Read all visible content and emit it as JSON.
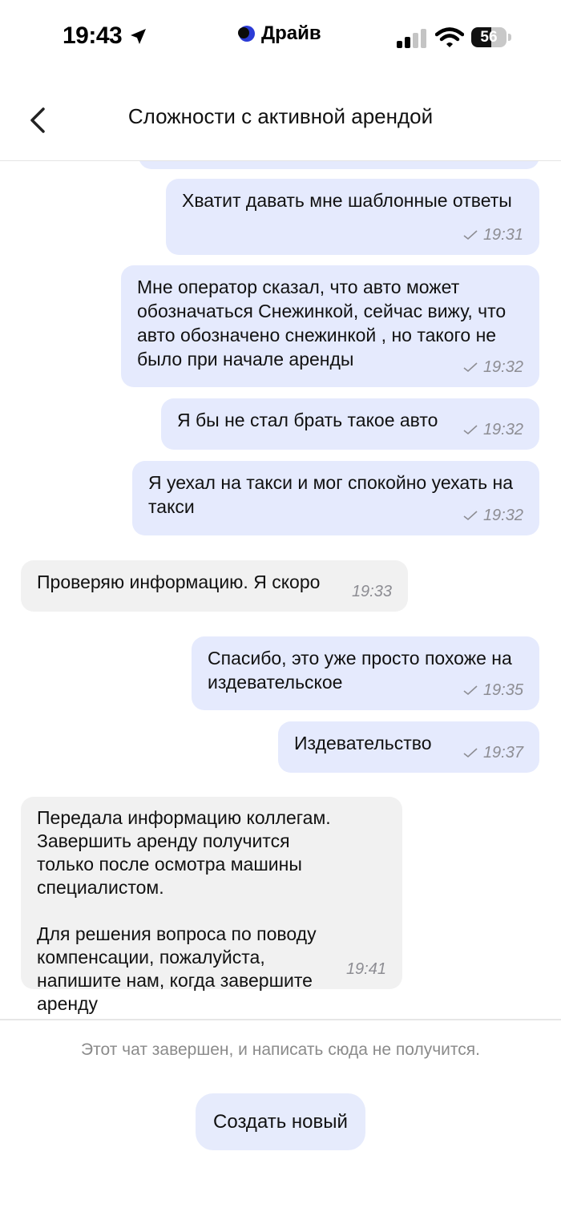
{
  "status_bar": {
    "time": "19:43",
    "app_name": "Драйв",
    "battery_level": "56"
  },
  "header": {
    "title": "Сложности с активной арендой"
  },
  "messages": [
    {
      "direction": "out",
      "text": "Хватит давать мне шаблонные ответы",
      "time": "19:31",
      "read": true
    },
    {
      "direction": "out",
      "text": "Мне оператор сказал, что авто может обозначаться Снежинкой, сейчас вижу, что авто обозначено снежинкой , но такого не было при начале аренды",
      "time": "19:32",
      "read": true
    },
    {
      "direction": "out",
      "text": "Я бы не стал брать такое авто",
      "time": "19:32",
      "read": true
    },
    {
      "direction": "out",
      "text": "Я уехал на такси и мог спокойно уехать на такси",
      "time": "19:32",
      "read": true
    },
    {
      "direction": "in",
      "text": "Проверяю информацию. Я скоро",
      "time": "19:33"
    },
    {
      "direction": "out",
      "text": "Спасибо, это уже просто похоже на издевательское",
      "time": "19:35",
      "read": true
    },
    {
      "direction": "out",
      "text": "Издевательство",
      "time": "19:37",
      "read": true
    },
    {
      "direction": "in",
      "text": "Передала информацию коллегам.\nЗавершить аренду получится только после осмотра машины специалистом.\n\nДля решения вопроса по поводу компенсации, пожалуйста, напишите нам, когда завершите аренду",
      "time": "19:41"
    }
  ],
  "footer": {
    "closed_notice": "Этот чат завершен, и написать сюда не получится.",
    "new_chat_label": "Создать новый"
  },
  "colors": {
    "outgoing_bubble": "#e5eafd",
    "incoming_bubble": "#f1f1f1",
    "timestamp": "#8d8d93"
  }
}
